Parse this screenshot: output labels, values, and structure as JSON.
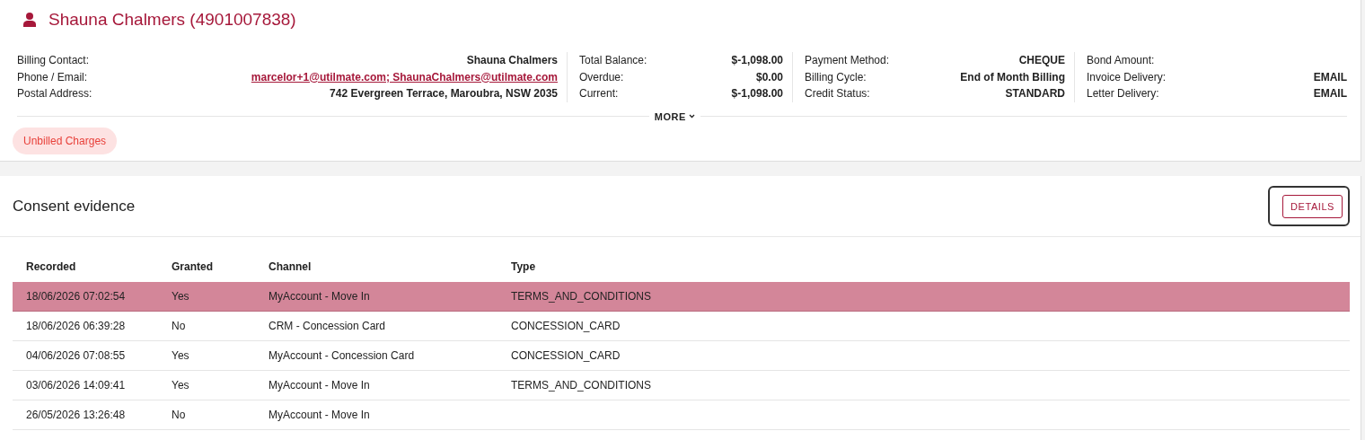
{
  "customer": {
    "title": "Shauna Chalmers (4901007838)"
  },
  "info_columns": [
    {
      "fields": [
        {
          "label": "Billing Contact:",
          "value": "Shauna Chalmers",
          "kind": "text"
        },
        {
          "label": "Phone / Email:",
          "value": "marcelor+1@utilmate.com; ShaunaChalmers@utilmate.com",
          "kind": "link"
        },
        {
          "label": "Postal Address:",
          "value": "742 Evergreen Terrace, Maroubra, NSW 2035",
          "kind": "text"
        }
      ]
    },
    {
      "fields": [
        {
          "label": "Total Balance:",
          "value": "$-1,098.00",
          "kind": "text"
        },
        {
          "label": "Overdue:",
          "value": "$0.00",
          "kind": "text"
        },
        {
          "label": "Current:",
          "value": "$-1,098.00",
          "kind": "text"
        }
      ]
    },
    {
      "fields": [
        {
          "label": "Payment Method:",
          "value": "CHEQUE",
          "kind": "text"
        },
        {
          "label": "Billing Cycle:",
          "value": "End of Month Billing",
          "kind": "text"
        },
        {
          "label": "Credit Status:",
          "value": "STANDARD",
          "kind": "text"
        }
      ]
    },
    {
      "fields": [
        {
          "label": "Bond Amount:",
          "kind": "text"
        },
        {
          "label": "Invoice Delivery:",
          "value": "EMAIL",
          "kind": "text"
        },
        {
          "label": "Letter Delivery:",
          "value": "EMAIL",
          "kind": "text"
        }
      ]
    }
  ],
  "more_button": {
    "label": "MORE"
  },
  "badges": [
    "Unbilled Charges"
  ],
  "consent": {
    "title": "Consent evidence",
    "details_button": {
      "label": "DETAILS",
      "focused": true
    },
    "columns": [
      "Recorded",
      "Granted",
      "Channel",
      "Type"
    ],
    "rows": [
      {
        "cells": [
          "18/06/2026 07:02:54",
          "Yes",
          "MyAccount - Move In",
          "TERMS_AND_CONDITIONS"
        ],
        "selected": true
      },
      {
        "cells": [
          "18/06/2026 06:39:28",
          "No",
          "CRM - Concession Card",
          "CONCESSION_CARD"
        ],
        "selected": false
      },
      {
        "cells": [
          "04/06/2026 07:08:55",
          "Yes",
          "MyAccount - Concession Card",
          "CONCESSION_CARD"
        ],
        "selected": false
      },
      {
        "cells": [
          "03/06/2026 14:09:41",
          "Yes",
          "MyAccount - Move In",
          "TERMS_AND_CONDITIONS"
        ],
        "selected": false
      },
      {
        "cells": [
          "26/05/2026 13:26:48",
          "No",
          "MyAccount - Move In",
          ""
        ],
        "selected": false
      }
    ]
  }
}
